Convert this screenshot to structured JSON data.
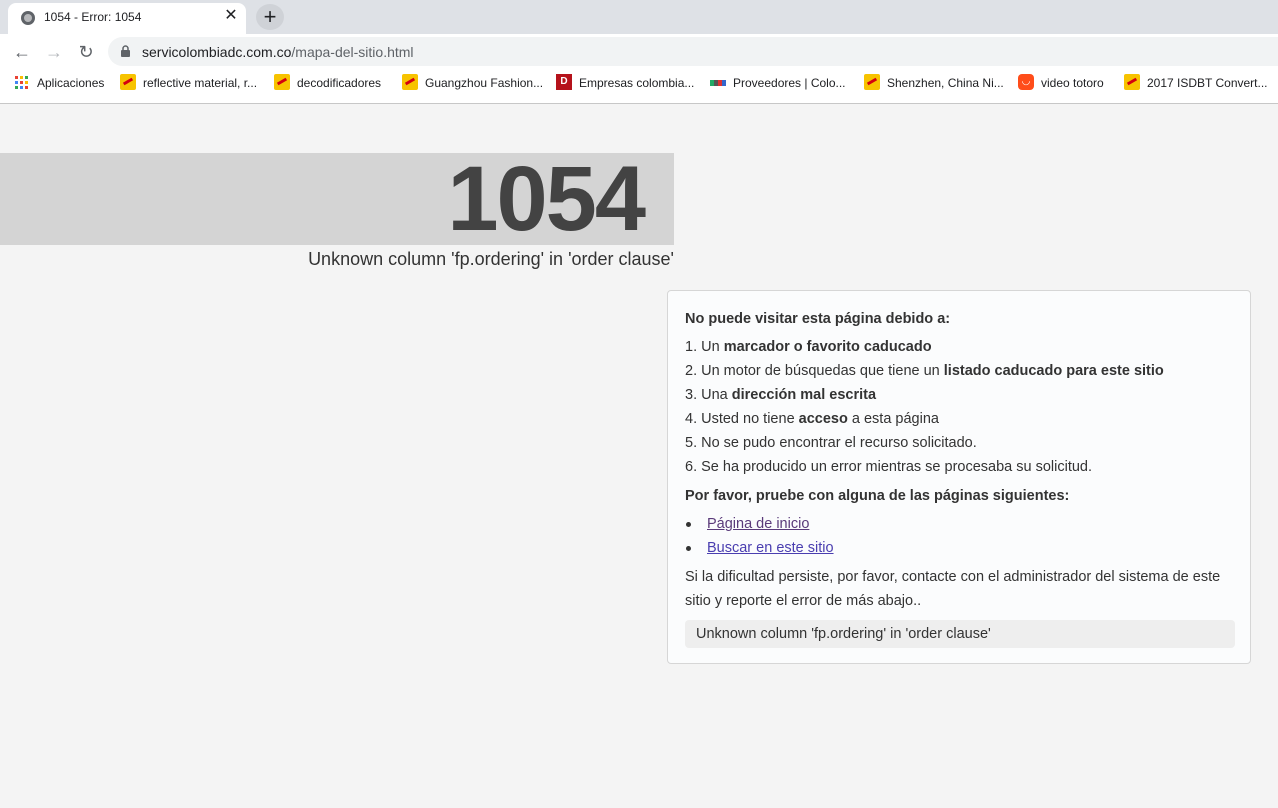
{
  "browser": {
    "tab_title": "1054 - Error: 1054",
    "tab_close": "✕",
    "new_tab": "+",
    "url_domain": "servicolombiadc.com.co",
    "url_path": "/mapa-del-sitio.html",
    "nav": {
      "back": "←",
      "forward": "→",
      "reload": "↻"
    },
    "bookmarks": [
      {
        "label": "Aplicaciones",
        "icon": "apps-grid-icon"
      },
      {
        "label": "reflective material, r...",
        "icon": "alibaba-star-icon"
      },
      {
        "label": "decodificadores",
        "icon": "alibaba-star-icon"
      },
      {
        "label": "Guangzhou Fashion...",
        "icon": "alibaba-star-icon"
      },
      {
        "label": "Empresas colombia...",
        "icon": "dt-icon"
      },
      {
        "label": "Proveedores | Colo...",
        "icon": "bars-icon"
      },
      {
        "label": "Shenzhen, China Ni...",
        "icon": "alibaba-star-icon"
      },
      {
        "label": "video totoro",
        "icon": "aliexpress-icon"
      },
      {
        "label": "2017 ISDBT Convert...",
        "icon": "alibaba-star-icon"
      }
    ]
  },
  "page": {
    "error_code": "1054",
    "error_message": "Unknown column 'fp.ordering' in 'order clause'",
    "info": {
      "heading": "No puede visitar esta página debido a:",
      "reasons": [
        {
          "pre": "1. Un ",
          "bold": "marcador o favorito caducado",
          "post": ""
        },
        {
          "pre": "2. Un motor de búsquedas que tiene un ",
          "bold": "listado caducado para este sitio",
          "post": ""
        },
        {
          "pre": "3. Una ",
          "bold": "dirección mal escrita",
          "post": ""
        },
        {
          "pre": "4. Usted no tiene ",
          "bold": "acceso",
          "post": " a esta página"
        },
        {
          "pre": "5. No se pudo encontrar el recurso solicitado.",
          "bold": "",
          "post": ""
        },
        {
          "pre": "6. Se ha producido un error mientras se procesaba su solicitud.",
          "bold": "",
          "post": ""
        }
      ],
      "try_heading": "Por favor, pruebe con alguna de las páginas siguientes:",
      "links": [
        "Página de inicio",
        "Buscar en este sitio"
      ],
      "persist": "Si la dificultad persiste, por favor, contacte con el administrador del sistema de este sitio y reporte el error de más abajo..",
      "error_detail": "Unknown column 'fp.ordering' in 'order clause'"
    }
  }
}
